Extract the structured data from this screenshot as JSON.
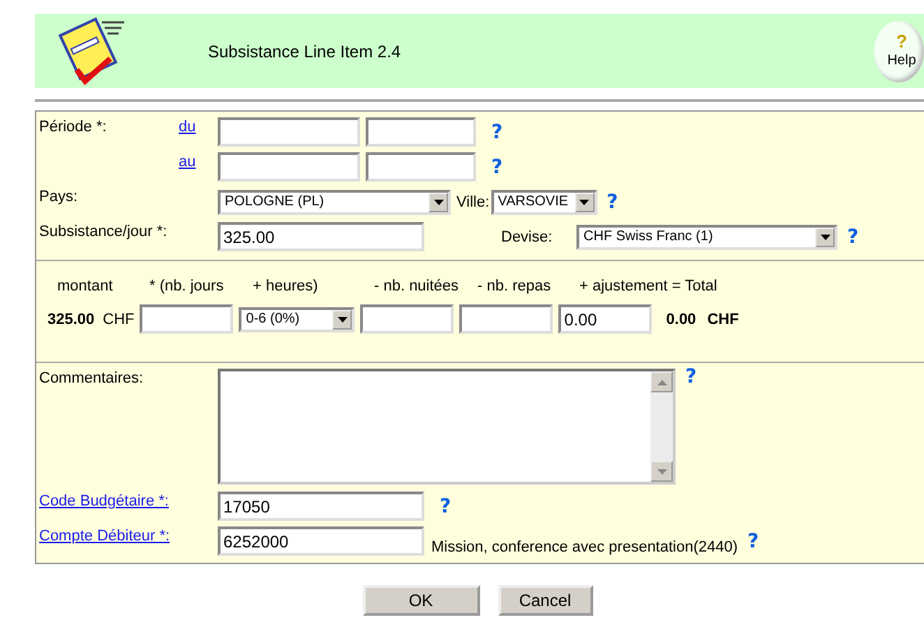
{
  "header": {
    "title": "Subsistance Line Item 2.4",
    "help_button": {
      "glyph": "?",
      "label": "Help"
    }
  },
  "periode": {
    "label": "Période *:",
    "rows": [
      {
        "link": "du",
        "help": "?"
      },
      {
        "link": "au",
        "help": "?"
      }
    ]
  },
  "pays": {
    "label": "Pays:",
    "value": "POLOGNE (PL)",
    "ville_label": "Ville:",
    "ville_value": "VARSOVIE",
    "help": "?"
  },
  "subsistance": {
    "label": "Subsistance/jour *:",
    "value": "325.00",
    "devise_label": "Devise:",
    "devise_value": "CHF Swiss Franc (1)",
    "help": "?"
  },
  "calc": {
    "headers": [
      "montant",
      "* (nb. jours",
      "+ heures)",
      "- nb. nuitées",
      "- nb. repas",
      "+ ajustement = Total"
    ],
    "amount": "325.00",
    "amount_currency": "CHF",
    "heures": "0-6 (0%)",
    "ajustement": "0.00",
    "total": "0.00",
    "total_currency": "CHF"
  },
  "commentaires": {
    "label": "Commentaires:",
    "help": "?"
  },
  "code_budgetaire": {
    "label": "Code Budgétaire *:",
    "value": "17050",
    "help": "?"
  },
  "compte_debiteur": {
    "label": "Compte Débiteur *:",
    "value": "6252000",
    "description": "Mission, conference avec presentation(2440)",
    "help": "?"
  },
  "buttons": [
    "OK",
    "Cancel"
  ]
}
